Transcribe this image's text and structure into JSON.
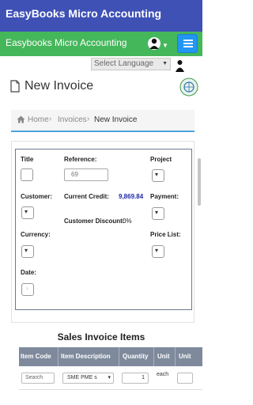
{
  "app": {
    "title": "EasyBooks Micro Accounting"
  },
  "nav": {
    "brand": "Easybooks Micro Accounting"
  },
  "language": {
    "selected": "Select Language"
  },
  "page": {
    "title": "New Invoice"
  },
  "breadcrumb": {
    "home": "Home",
    "invoices": "Invoices",
    "current": "New Invoice"
  },
  "form": {
    "title_label": "Title",
    "reference_label": "Reference:",
    "reference_placeholder": "69",
    "project_label": "Project",
    "customer_label": "Customer:",
    "current_credit_label": "Current Credit:",
    "current_credit_value": "9,869.84",
    "payment_label": "Payment:",
    "customer_discount_label": "Customer Discount:",
    "customer_discount_value": "0%",
    "currency_label": "Currency:",
    "price_list_label": "Price List:",
    "date_label": "Date:"
  },
  "items": {
    "title": "Sales Invoice Items",
    "columns": [
      "Item Code",
      "Item Description",
      "Quantity",
      "Unit",
      "Unit"
    ],
    "row": {
      "search_placeholder": "Search",
      "description": "SME PME s",
      "quantity": "1",
      "unit": "each"
    }
  },
  "colors": {
    "appbar": "#3f51b5",
    "nav": "#45b75b",
    "menu_button": "#2196f3",
    "table_header": "#7e8a9c",
    "credit_value": "#1e2aa8"
  },
  "icons": [
    "avatar-icon",
    "menu-icon",
    "document-icon",
    "globe-icon",
    "home-icon",
    "chevron-right-icon",
    "chevron-down-icon"
  ]
}
